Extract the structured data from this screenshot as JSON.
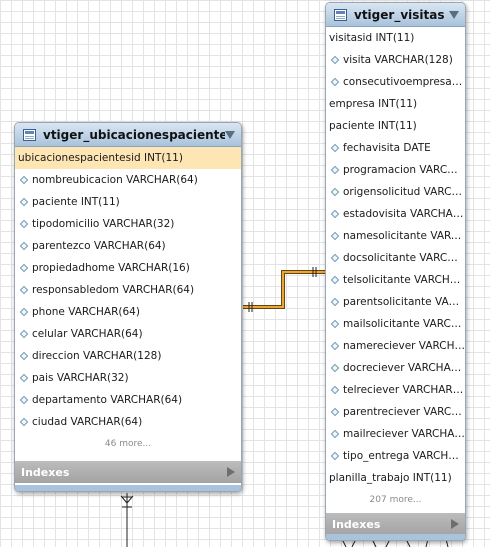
{
  "tables": {
    "ubicaciones": {
      "title": "vtiger_ubicacionespacientes",
      "primary_key": "ubicacionespacientesid INT(11)",
      "columns": [
        "nombreubicacion VARCHAR(64)",
        "paciente INT(11)",
        "tipodomicilio VARCHAR(32)",
        "parentezco VARCHAR(64)",
        "propiedadhome VARCHAR(16)",
        "responsabledom VARCHAR(64)",
        "phone VARCHAR(64)",
        "celular VARCHAR(64)",
        "direccion VARCHAR(128)",
        "pais VARCHAR(32)",
        "departamento VARCHAR(64)",
        "ciudad VARCHAR(64)"
      ],
      "more": "46 more...",
      "indexes_label": "Indexes"
    },
    "visitas": {
      "title": "vtiger_visitas",
      "rows": [
        {
          "text": "visitasid INT(11)",
          "icon": ""
        },
        {
          "text": "visita VARCHAR(128)",
          "icon": "diamond"
        },
        {
          "text": "consecutivoempresa I...",
          "icon": "diamond"
        },
        {
          "text": "empresa INT(11)",
          "icon": ""
        },
        {
          "text": "paciente INT(11)",
          "icon": ""
        },
        {
          "text": "fechavisita DATE",
          "icon": "diamond"
        },
        {
          "text": "programacion VARCHA...",
          "icon": "diamond"
        },
        {
          "text": "origensolicitud VARCH...",
          "icon": "diamond"
        },
        {
          "text": "estadovisita VARCHAR(...",
          "icon": "diamond"
        },
        {
          "text": "namesolicitante VARCH...",
          "icon": "diamond"
        },
        {
          "text": "docsolicitante VARCHA...",
          "icon": "diamond"
        },
        {
          "text": "telsolicitante VARCHAR...",
          "icon": "diamond"
        },
        {
          "text": "parentsolicitante VARC...",
          "icon": "diamond"
        },
        {
          "text": "mailsolicitante VARCHA...",
          "icon": "diamond"
        },
        {
          "text": "namereciever VARCHAR(...",
          "icon": "diamond"
        },
        {
          "text": "docreciever VARCHAR(...",
          "icon": "diamond"
        },
        {
          "text": "telreciever VARCHAR(64)",
          "icon": "diamond"
        },
        {
          "text": "parentreciever VARCH...",
          "icon": "diamond"
        },
        {
          "text": "mailreciever VARCHAR...",
          "icon": "diamond"
        },
        {
          "text": "tipo_entrega VARCHAR...",
          "icon": "diamond"
        },
        {
          "text": "planilla_trabajo INT(11)",
          "icon": ""
        }
      ],
      "more": "207 more...",
      "indexes_label": "Indexes"
    }
  },
  "colors": {
    "header": "#a9c3dc",
    "primary_key_row": "#fde6b4",
    "relationship_line": "#c8861a",
    "indexes_bar": "#adadad"
  },
  "icons": {
    "table": "table-icon",
    "column": "column-diamond-icon",
    "collapse": "collapse-arrow-icon",
    "expand_indexes": "expand-arrow-icon"
  }
}
